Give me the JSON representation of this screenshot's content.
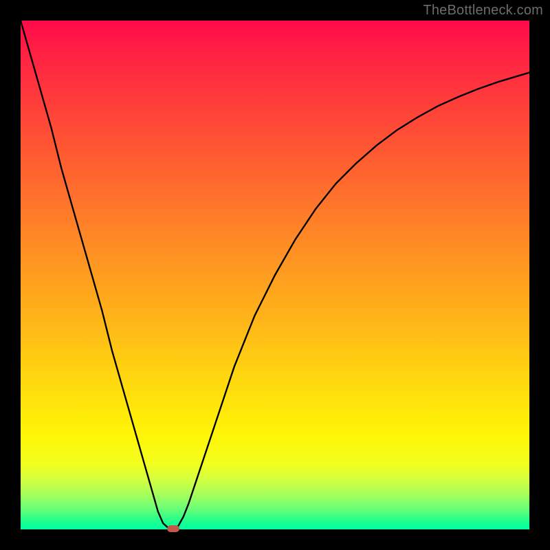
{
  "watermark": "TheBottleneck.com",
  "colors": {
    "frame": "#000000",
    "curve_stroke": "#000000",
    "marker_fill": "#c1594d",
    "watermark_text": "#6c6c6c",
    "gradient_top": "#ff0a4a",
    "gradient_bottom": "#00ffa2"
  },
  "chart_data": {
    "type": "line",
    "title": "",
    "xlabel": "",
    "ylabel": "",
    "xlim": [
      0,
      100
    ],
    "ylim": [
      0,
      100
    ],
    "grid": false,
    "legend": false,
    "annotations": [
      "TheBottleneck.com"
    ],
    "series": [
      {
        "name": "bottleneck-curve",
        "x": [
          0,
          2,
          4,
          6,
          8,
          10,
          12,
          14,
          16,
          18,
          20,
          22,
          24,
          26,
          27,
          28,
          29,
          30,
          31,
          32,
          33,
          34,
          36,
          38,
          40,
          42,
          44,
          46,
          48,
          50,
          54,
          58,
          62,
          66,
          70,
          74,
          78,
          82,
          86,
          90,
          94,
          98,
          100
        ],
        "y": [
          100,
          93,
          86,
          79,
          71,
          64,
          57,
          50,
          43,
          35,
          28,
          21,
          14,
          7,
          3.5,
          1.2,
          0.3,
          0,
          0.7,
          2.5,
          5,
          8,
          14,
          20,
          26,
          32,
          37,
          42,
          46,
          50,
          57,
          63,
          68,
          72,
          75.5,
          78.5,
          81,
          83.2,
          85,
          86.6,
          88,
          89.2,
          89.8
        ]
      }
    ],
    "marker": {
      "x": 30,
      "y": 0,
      "shape": "pill",
      "color": "#c1594d"
    }
  }
}
